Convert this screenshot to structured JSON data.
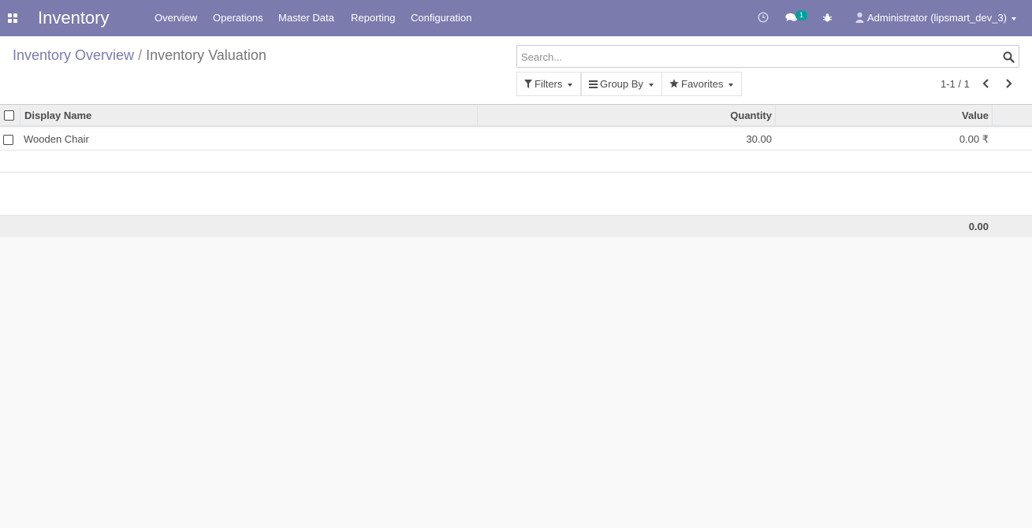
{
  "app": {
    "title": "Inventory"
  },
  "menu": [
    "Overview",
    "Operations",
    "Master Data",
    "Reporting",
    "Configuration"
  ],
  "systray": {
    "messages_badge": "1",
    "user": "Administrator (lipsmart_dev_3)"
  },
  "breadcrumb": {
    "parent": "Inventory Overview",
    "separator": "/",
    "current": "Inventory Valuation"
  },
  "search": {
    "placeholder": "Search..."
  },
  "filters": {
    "filters_label": "Filters",
    "group_by_label": "Group By",
    "favorites_label": "Favorites"
  },
  "pager": {
    "range": "1-1 / 1"
  },
  "table": {
    "columns": {
      "name": "Display Name",
      "quantity": "Quantity",
      "value": "Value"
    },
    "rows": [
      {
        "name": "Wooden Chair",
        "quantity": "30.00",
        "value": "0.00 ₹"
      }
    ],
    "total_value": "0.00"
  },
  "colors": {
    "navbar": "#7c7bad",
    "badge": "#00a09d",
    "breadcrumb_link": "#7c7bad"
  }
}
